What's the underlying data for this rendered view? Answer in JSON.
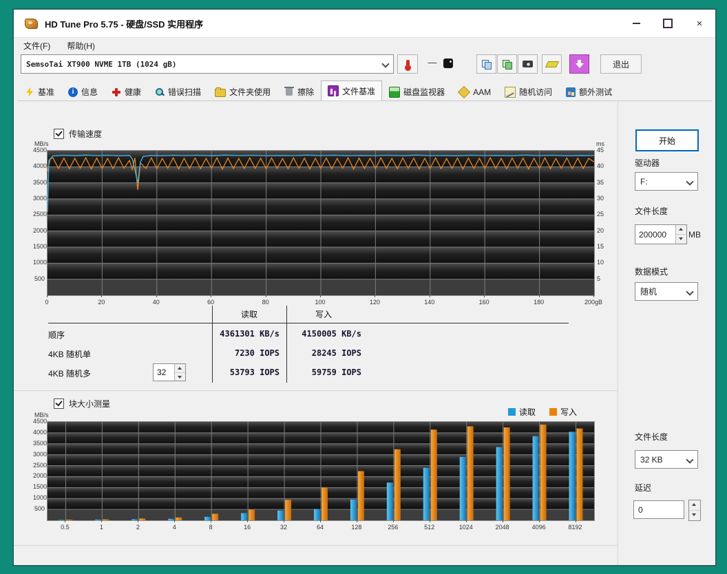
{
  "window": {
    "title": "HD Tune Pro 5.75 - 硬盘/SSD 实用程序",
    "controls": {
      "close": "×"
    }
  },
  "menu": {
    "items": [
      "文件(F)",
      "帮助(H)"
    ]
  },
  "toolbar": {
    "drive_selector": "SemsoTai XT900 NVME 1TB (1024 gB)",
    "temperature_value": "—",
    "exit_label": "退出",
    "icon_buttons": [
      "thermometer-icon",
      "temperature-chip-icon",
      "copy-icon",
      "report-icon",
      "camera-icon",
      "highlight-icon",
      "download-icon"
    ]
  },
  "tabs": [
    {
      "id": "benchmark",
      "icon": "lightning-icon",
      "label": "基准",
      "active": false
    },
    {
      "id": "info",
      "icon": "info-icon",
      "label": "信息",
      "active": false
    },
    {
      "id": "health",
      "icon": "health-cross-icon",
      "label": "健康",
      "active": false
    },
    {
      "id": "error-scan",
      "icon": "magnifier-icon",
      "label": "错误扫描",
      "active": false
    },
    {
      "id": "folder-usage",
      "icon": "folder-icon",
      "label": "文件夹使用",
      "active": false
    },
    {
      "id": "erase",
      "icon": "trash-icon",
      "label": "擦除",
      "active": false
    },
    {
      "id": "file-benchmark",
      "icon": "file-benchmark-icon",
      "label": "文件基准",
      "active": true
    },
    {
      "id": "disk-monitor",
      "icon": "disk-monitor-icon",
      "label": "磁盘监视器",
      "active": false
    },
    {
      "id": "aam",
      "icon": "speaker-icon",
      "label": "AAM",
      "active": false
    },
    {
      "id": "random-access",
      "icon": "random-access-icon",
      "label": "随机访问",
      "active": false
    },
    {
      "id": "extra-tests",
      "icon": "extra-tests-icon",
      "label": "额外测试",
      "active": false
    }
  ],
  "transfer_section": {
    "checkbox_label": "传输速度"
  },
  "results_table": {
    "col_read": "读取",
    "col_write": "写入",
    "rows": [
      {
        "label": "顺序",
        "read": "4361301 KB/s",
        "write": "4150005 KB/s"
      },
      {
        "label": "4KB 随机单",
        "read": "7230 IOPS",
        "write": "28245 IOPS"
      },
      {
        "label": "4KB 随机多",
        "read": "53793 IOPS",
        "write": "59759 IOPS",
        "spinner": "32"
      }
    ]
  },
  "block_section": {
    "checkbox_label": "块大小测量",
    "legend": [
      {
        "label": "读取",
        "color": "#1f9ad6"
      },
      {
        "label": "写入",
        "color": "#e8820c"
      }
    ]
  },
  "side_panel": {
    "start_button": "开始",
    "drive_label": "驱动器",
    "drive_value": "F:",
    "file_length_label": "文件长度",
    "file_length_value": "200000",
    "file_length_unit": "MB",
    "data_mode_label": "数据模式",
    "data_mode_value": "随机",
    "block_file_length_label": "文件长度",
    "block_file_length_value": "32 KB",
    "delay_label": "延迟",
    "delay_value": "0"
  },
  "chart_data": [
    {
      "type": "line",
      "title": "传输速度",
      "y_left_label": "MB/s",
      "y_right_label": "ms",
      "ylim": [
        0,
        4500
      ],
      "y_left_ticks": [
        4500,
        4000,
        3500,
        3000,
        2500,
        2000,
        1500,
        1000,
        500
      ],
      "y_right_max": 45,
      "y_right_ticks": [
        45,
        40,
        35,
        30,
        25,
        20,
        15,
        10,
        5
      ],
      "xlim": [
        0,
        200
      ],
      "x_grid": [
        20,
        40,
        60,
        80,
        100,
        120,
        140,
        160,
        180
      ],
      "x_ticks": [
        {
          "v": 0,
          "label": "0"
        },
        {
          "v": 20,
          "label": "20"
        },
        {
          "v": 40,
          "label": "40"
        },
        {
          "v": 60,
          "label": "60"
        },
        {
          "v": 80,
          "label": "80"
        },
        {
          "v": 100,
          "label": "100"
        },
        {
          "v": 120,
          "label": "120"
        },
        {
          "v": 140,
          "label": "140"
        },
        {
          "v": 160,
          "label": "160"
        },
        {
          "v": 180,
          "label": "180"
        },
        {
          "v": 200,
          "label": "200gB"
        }
      ],
      "series": [
        {
          "name": "写入",
          "color": "#e8851a",
          "points": [
            [
              0,
              3850
            ],
            [
              1,
              4250
            ],
            [
              2,
              4280
            ],
            [
              4,
              3950
            ],
            [
              6,
              4270
            ],
            [
              8,
              3940
            ],
            [
              10,
              4265
            ],
            [
              12,
              3955
            ],
            [
              14,
              4280
            ],
            [
              16,
              3935
            ],
            [
              18,
              4270
            ],
            [
              20,
              3950
            ],
            [
              22,
              4260
            ],
            [
              24,
              3945
            ],
            [
              26,
              4280
            ],
            [
              28,
              3955
            ],
            [
              30,
              4200
            ],
            [
              31,
              3920
            ],
            [
              32,
              4280
            ],
            [
              33,
              3280
            ],
            [
              34,
              4120
            ],
            [
              36,
              3950
            ],
            [
              38,
              4275
            ],
            [
              40,
              3940
            ],
            [
              42,
              4260
            ],
            [
              44,
              3955
            ],
            [
              46,
              4280
            ],
            [
              48,
              3935
            ],
            [
              50,
              4265
            ],
            [
              52,
              3950
            ],
            [
              54,
              4275
            ],
            [
              56,
              3940
            ],
            [
              58,
              4260
            ],
            [
              60,
              3955
            ],
            [
              62,
              4280
            ],
            [
              64,
              3930
            ],
            [
              66,
              4270
            ],
            [
              68,
              3950
            ],
            [
              70,
              4260
            ],
            [
              72,
              3945
            ],
            [
              74,
              4280
            ],
            [
              76,
              3952
            ],
            [
              78,
              4265
            ],
            [
              80,
              3936
            ],
            [
              82,
              4275
            ],
            [
              84,
              3950
            ],
            [
              86,
              4258
            ],
            [
              88,
              3940
            ],
            [
              90,
              4280
            ],
            [
              92,
              3955
            ],
            [
              94,
              4268
            ],
            [
              96,
              3934
            ],
            [
              98,
              4264
            ],
            [
              100,
              3950
            ],
            [
              102,
              4276
            ],
            [
              104,
              3940
            ],
            [
              106,
              4260
            ],
            [
              108,
              3956
            ],
            [
              110,
              4280
            ],
            [
              112,
              3930
            ],
            [
              114,
              4270
            ],
            [
              116,
              3950
            ],
            [
              118,
              4264
            ],
            [
              120,
              3944
            ],
            [
              122,
              4280
            ],
            [
              124,
              3952
            ],
            [
              126,
              4260
            ],
            [
              128,
              3938
            ],
            [
              130,
              4274
            ],
            [
              132,
              3955
            ],
            [
              134,
              4268
            ],
            [
              136,
              3934
            ],
            [
              138,
              4264
            ],
            [
              140,
              3950
            ],
            [
              142,
              4280
            ],
            [
              144,
              3940
            ],
            [
              146,
              4258
            ],
            [
              148,
              3956
            ],
            [
              150,
              4274
            ],
            [
              152,
              3930
            ],
            [
              154,
              4270
            ],
            [
              156,
              3950
            ],
            [
              158,
              4264
            ],
            [
              160,
              3944
            ],
            [
              162,
              4280
            ],
            [
              164,
              3952
            ],
            [
              166,
              4260
            ],
            [
              168,
              3938
            ],
            [
              170,
              4274
            ],
            [
              172,
              3955
            ],
            [
              174,
              4268
            ],
            [
              176,
              3934
            ],
            [
              178,
              4264
            ],
            [
              180,
              3950
            ],
            [
              182,
              4280
            ],
            [
              184,
              3940
            ],
            [
              186,
              4258
            ],
            [
              188,
              3956
            ],
            [
              190,
              4274
            ],
            [
              192,
              3944
            ],
            [
              194,
              4268
            ],
            [
              196,
              3950
            ],
            [
              198,
              4260
            ],
            [
              200,
              4150
            ]
          ]
        },
        {
          "name": "读取",
          "color": "#41b6e9",
          "points": [
            [
              0,
              2600
            ],
            [
              0.5,
              4200
            ],
            [
              2,
              4340
            ],
            [
              6,
              4360
            ],
            [
              10,
              4345
            ],
            [
              14,
              4365
            ],
            [
              18,
              4350
            ],
            [
              22,
              4360
            ],
            [
              26,
              4345
            ],
            [
              30,
              4355
            ],
            [
              31,
              4250
            ],
            [
              32,
              3900
            ],
            [
              33,
              3500
            ],
            [
              34,
              4150
            ],
            [
              35,
              4320
            ],
            [
              38,
              4355
            ],
            [
              42,
              4345
            ],
            [
              46,
              4360
            ],
            [
              50,
              4350
            ],
            [
              55,
              4360
            ],
            [
              60,
              4345
            ],
            [
              65,
              4365
            ],
            [
              70,
              4350
            ],
            [
              75,
              4360
            ],
            [
              80,
              4345
            ],
            [
              85,
              4355
            ],
            [
              90,
              4350
            ],
            [
              95,
              4365
            ],
            [
              100,
              4350
            ],
            [
              105,
              4360
            ],
            [
              110,
              4345
            ],
            [
              115,
              4355
            ],
            [
              120,
              4350
            ],
            [
              125,
              4360
            ],
            [
              130,
              4345
            ],
            [
              135,
              4365
            ],
            [
              140,
              4350
            ],
            [
              145,
              4355
            ],
            [
              150,
              4345
            ],
            [
              155,
              4360
            ],
            [
              160,
              4350
            ],
            [
              165,
              4355
            ],
            [
              170,
              4345
            ],
            [
              175,
              4365
            ],
            [
              180,
              4350
            ],
            [
              185,
              4360
            ],
            [
              190,
              4345
            ],
            [
              195,
              4355
            ],
            [
              200,
              4350
            ]
          ]
        }
      ]
    },
    {
      "type": "bar",
      "title": "块大小测量",
      "ylabel": "MB/s",
      "ylim": [
        0,
        4500
      ],
      "y_ticks": [
        4500,
        4000,
        3500,
        3000,
        2500,
        2000,
        1500,
        1000,
        500
      ],
      "categories": [
        "0.5",
        "1",
        "2",
        "4",
        "8",
        "16",
        "32",
        "64",
        "128",
        "256",
        "512",
        "1024",
        "2048",
        "4096",
        "8192"
      ],
      "series": [
        {
          "name": "读取",
          "color": "#2196d6",
          "values": [
            20,
            35,
            50,
            70,
            160,
            330,
            450,
            520,
            950,
            1730,
            2400,
            2900,
            3350,
            3850,
            4050
          ]
        },
        {
          "name": "写入",
          "color": "#e87e0e",
          "values": [
            30,
            45,
            85,
            130,
            300,
            490,
            940,
            1500,
            2250,
            3250,
            4150,
            4300,
            4250,
            4380,
            4200
          ]
        }
      ]
    }
  ]
}
